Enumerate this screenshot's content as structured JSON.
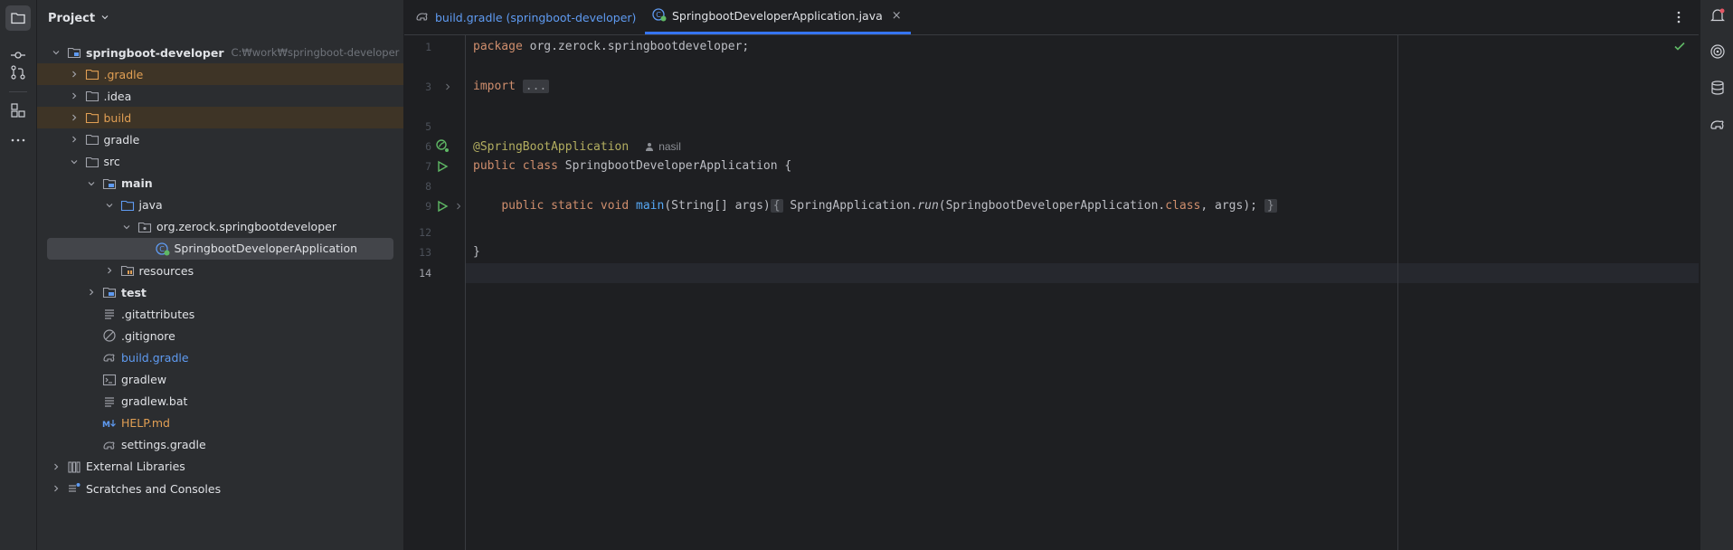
{
  "left_strip": {
    "icons": [
      "project-folder-icon",
      "commit-icon",
      "pull-requests-icon",
      "structure-icon",
      "more-icon"
    ]
  },
  "project_panel": {
    "title": "Project",
    "tree": [
      {
        "label": "springboot-developer",
        "path": "C:₩work₩springboot-developer",
        "depth": 0,
        "expanded": true,
        "icon": "module-folder-icon",
        "style": "bold"
      },
      {
        "label": ".gradle",
        "depth": 1,
        "expanded": false,
        "icon": "folder-orange-icon",
        "style": "orange",
        "highlight": true
      },
      {
        "label": ".idea",
        "depth": 1,
        "expanded": false,
        "icon": "folder-icon",
        "style": "normal"
      },
      {
        "label": "build",
        "depth": 1,
        "expanded": false,
        "icon": "folder-orange-icon",
        "style": "orange",
        "highlight": true
      },
      {
        "label": "gradle",
        "depth": 1,
        "expanded": false,
        "icon": "folder-icon",
        "style": "normal"
      },
      {
        "label": "src",
        "depth": 1,
        "expanded": true,
        "icon": "folder-icon",
        "style": "normal"
      },
      {
        "label": "main",
        "depth": 2,
        "expanded": true,
        "icon": "source-folder-icon",
        "style": "bold"
      },
      {
        "label": "java",
        "depth": 3,
        "expanded": true,
        "icon": "java-source-folder-icon",
        "style": "normal"
      },
      {
        "label": "org.zerock.springbootdeveloper",
        "depth": 4,
        "expanded": true,
        "icon": "package-icon",
        "style": "normal"
      },
      {
        "label": "SpringbootDeveloperApplication",
        "depth": 5,
        "expanded": null,
        "icon": "spring-class-icon",
        "style": "normal",
        "selected": true
      },
      {
        "label": "resources",
        "depth": 3,
        "expanded": false,
        "icon": "resources-folder-icon",
        "style": "normal"
      },
      {
        "label": "test",
        "depth": 2,
        "expanded": false,
        "icon": "source-folder-icon",
        "style": "bold"
      },
      {
        "label": ".gitattributes",
        "depth": 2,
        "expanded": null,
        "icon": "text-file-icon",
        "style": "normal"
      },
      {
        "label": ".gitignore",
        "depth": 2,
        "expanded": null,
        "icon": "ignore-file-icon",
        "style": "normal"
      },
      {
        "label": "build.gradle",
        "depth": 2,
        "expanded": null,
        "icon": "gradle-elephant-icon",
        "style": "blue"
      },
      {
        "label": "gradlew",
        "depth": 2,
        "expanded": null,
        "icon": "shell-script-icon",
        "style": "normal"
      },
      {
        "label": "gradlew.bat",
        "depth": 2,
        "expanded": null,
        "icon": "text-file-icon",
        "style": "normal"
      },
      {
        "label": "HELP.md",
        "depth": 2,
        "expanded": null,
        "icon": "markdown-icon",
        "style": "orange"
      },
      {
        "label": "settings.gradle",
        "depth": 2,
        "expanded": null,
        "icon": "gradle-elephant-icon",
        "style": "normal"
      },
      {
        "label": "External Libraries",
        "depth": 0,
        "expanded": false,
        "icon": "library-icon",
        "style": "normal"
      },
      {
        "label": "Scratches and Consoles",
        "depth": 0,
        "expanded": false,
        "icon": "scratches-icon",
        "style": "normal"
      }
    ]
  },
  "editor": {
    "tabs": [
      {
        "label": "build.gradle (springboot-developer)",
        "icon": "gradle-elephant-icon",
        "active": false,
        "color": "#5f9bf2"
      },
      {
        "label": "SpringbootDeveloperApplication.java",
        "icon": "spring-class-icon",
        "active": true,
        "color": "#dfe1e5",
        "close": "×"
      }
    ],
    "author_inlay": "nasil",
    "line_numbers": [
      "1",
      "3",
      "5",
      "6",
      "7",
      "8",
      "9",
      "12",
      "13",
      "14"
    ],
    "current_line": "14",
    "code": {
      "l1_kw": "package",
      "l1_rest": " org.zerock.springbootdeveloper;",
      "l3_kw": "import",
      "l3_fold": "...",
      "l6_ann": "@SpringBootApplication",
      "l7_kw": "public class",
      "l7_rest": " SpringbootDeveloperApplication {",
      "l9_indent": "    ",
      "l9_kw": "public static void",
      "l9_fn": "main",
      "l9_sig": "(String[] args)",
      "l9_fold_open": "{",
      "l9_body_a": " SpringApplication.",
      "l9_body_run": "run",
      "l9_body_b": "(SpringbootDeveloperApplication.",
      "l9_body_kw": "class",
      "l9_body_c": ", args); ",
      "l9_fold_close": "}",
      "l13": "}"
    }
  },
  "right_strip": {
    "icons": [
      "notifications-icon",
      "ai-assistant-icon",
      "database-icon",
      "gradle-elephant-icon"
    ]
  },
  "colors": {
    "accent": "#3574f0",
    "keyword": "#cf8e6d",
    "annotation": "#b3ae60",
    "function": "#56a8f5",
    "run_green": "#5fb865",
    "excluded_folder": "#e19f54"
  }
}
